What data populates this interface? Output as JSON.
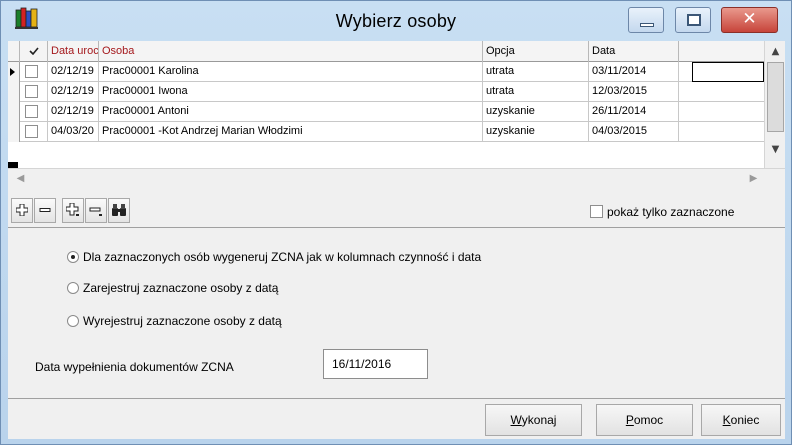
{
  "window": {
    "title": "Wybierz osoby",
    "close_glyph": "✕",
    "app_icon": "books-icon"
  },
  "grid": {
    "columns": [
      "Data uroc",
      "Osoba",
      "Opcja",
      "Data"
    ],
    "rows": [
      {
        "birth": "02/12/19",
        "person": "Prac00001 Karolina",
        "option": "utrata",
        "date": "03/11/2014"
      },
      {
        "birth": "02/12/19",
        "person": "Prac00001 Iwona",
        "option": "utrata",
        "date": "12/03/2015"
      },
      {
        "birth": "02/12/19",
        "person": "Prac00001 Antoni",
        "option": "uzyskanie",
        "date": "26/11/2014"
      },
      {
        "birth": "04/03/20",
        "person": "Prac00001   -Kot Andrzej Marian Włodzimi",
        "option": "uzyskanie",
        "date": "04/03/2015"
      }
    ]
  },
  "toolbar": {
    "buttons": [
      "add-icon",
      "remove-icon",
      "add-all-icon",
      "remove-all-icon",
      "binoculars-icon"
    ],
    "show_only_label": "pokaż tylko zaznaczone"
  },
  "options": {
    "opt1": "Dla zaznaczonych osób wygeneruj ZCNA jak w kolumnach czynność i data",
    "opt2": "Zarejestruj zaznaczone osoby z datą",
    "opt3": "Wyrejestruj zaznaczone osoby z datą",
    "selected": 1
  },
  "fill_date": {
    "label": "Data wypełnienia dokumentów  ZCNA",
    "value": "16/11/2016"
  },
  "buttons": {
    "execute_acc": "W",
    "execute_rest": "ykonaj",
    "help_acc": "P",
    "help_rest": "omoc",
    "end_acc": "K",
    "end_rest": "oniec"
  }
}
